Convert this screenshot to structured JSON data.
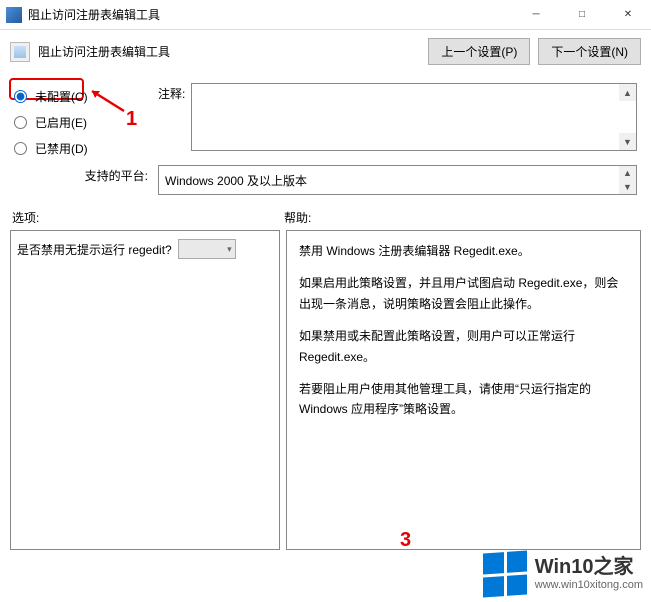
{
  "titlebar": {
    "title": "阻止访问注册表编辑工具"
  },
  "toolbar": {
    "subtitle": "阻止访问注册表编辑工具",
    "prev_label": "上一个设置(P)",
    "next_label": "下一个设置(N)"
  },
  "radios": {
    "not_configured": "未配置(C)",
    "enabled": "已启用(E)",
    "disabled": "已禁用(D)"
  },
  "annotations": {
    "one": "1",
    "three": "3"
  },
  "comment": {
    "label": "注释:",
    "value": ""
  },
  "platform": {
    "label": "支持的平台:",
    "value": "Windows 2000 及以上版本"
  },
  "sections": {
    "options_label": "选项:",
    "help_label": "帮助:"
  },
  "options": {
    "question": "是否禁用无提示运行 regedit?"
  },
  "help": {
    "p1": "禁用 Windows 注册表编辑器 Regedit.exe。",
    "p2": "如果启用此策略设置，并且用户试图启动 Regedit.exe，则会出现一条消息，说明策略设置会阻止此操作。",
    "p3": "如果禁用或未配置此策略设置，则用户可以正常运行 Regedit.exe。",
    "p4": "若要阻止用户使用其他管理工具，请使用“只运行指定的 Windows 应用程序”策略设置。"
  },
  "watermark": {
    "line1": "Win10之家",
    "line2": "www.win10xitong.com"
  }
}
